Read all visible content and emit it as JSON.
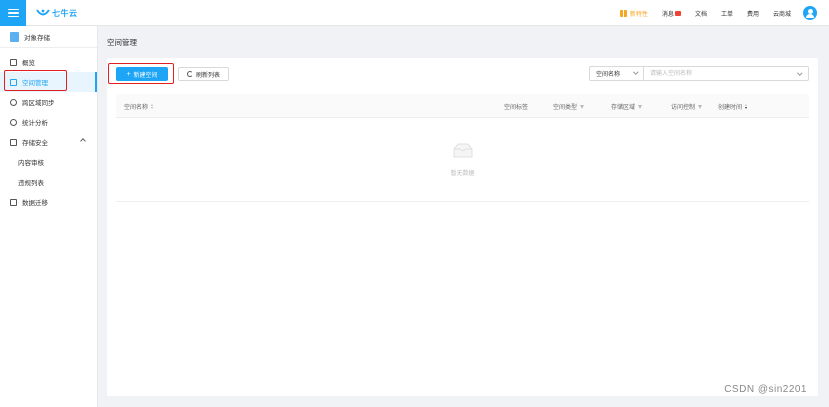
{
  "header": {
    "logo_text": "七牛云",
    "nav": {
      "new_label": "新特性",
      "messages_label": "消息",
      "docs_label": "文档",
      "tickets_label": "工单",
      "billing_label": "费用",
      "market_label": "云商城"
    }
  },
  "sidebar": {
    "product": "对象存储",
    "items": [
      {
        "label": "概览"
      },
      {
        "label": "空间管理"
      },
      {
        "label": "跨区域同步"
      },
      {
        "label": "统计分析"
      },
      {
        "label": "存储安全"
      },
      {
        "label": "内容审核"
      },
      {
        "label": "违规列表"
      },
      {
        "label": "数据迁移"
      }
    ]
  },
  "main": {
    "title": "空间管理",
    "new_button": "新建空间",
    "refresh_button": "刷新列表",
    "search": {
      "field_selected": "空间名称",
      "placeholder": "请输入空间名称"
    },
    "table": {
      "columns": [
        "空间名称",
        "空间标签",
        "空间类型",
        "存储区域",
        "访问控制",
        "创建时间"
      ],
      "empty_text": "暂无数据"
    }
  },
  "colors": {
    "accent": "#1ea5f5",
    "highlight_box": "#e02020"
  },
  "watermark": "CSDN @sin2201"
}
